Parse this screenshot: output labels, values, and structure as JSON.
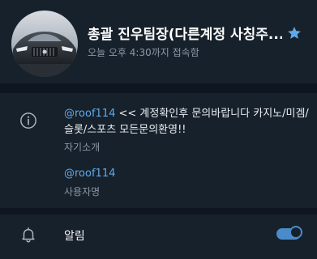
{
  "profile": {
    "title": "총괄 진우팀장(다른계정 사칭주...",
    "status": "오늘 오후 4:30까지 접속함"
  },
  "info": {
    "bio_mention": "@roof114",
    "bio_text": " << 계정확인후 문의바랍니다 카지노/미겜/슬롯/스포츠 모든문의환영!!",
    "bio_label": "자기소개",
    "username": "@roof114",
    "username_label": "사용자명"
  },
  "notifications": {
    "label": "알림",
    "enabled": true
  },
  "icons": {
    "header": "star-icon",
    "info": "info-icon",
    "bell": "bell-icon"
  },
  "colors": {
    "background": "#17212b",
    "separator": "#0e1621",
    "accent": "#5fa9e8",
    "secondary_text": "#8b98a6",
    "toggle": "#4a8bc9"
  }
}
